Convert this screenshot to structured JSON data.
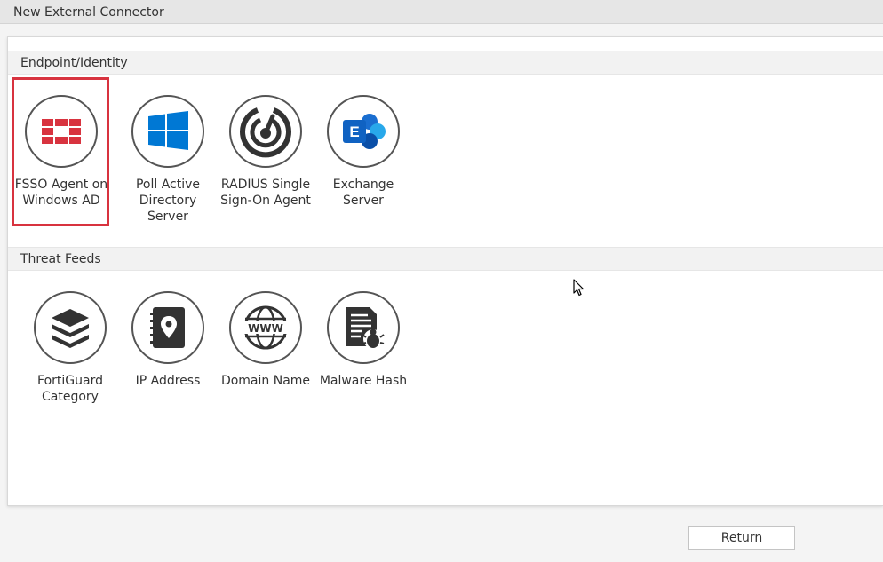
{
  "window": {
    "title": "New External Connector"
  },
  "sections": [
    {
      "title": "Endpoint/Identity",
      "items": [
        {
          "label": "FSSO Agent on\nWindows AD",
          "icon": "fortinet-logo-icon",
          "selected": true
        },
        {
          "label": "Poll Active\nDirectory\nServer",
          "icon": "windows-logo-icon",
          "selected": false
        },
        {
          "label": "RADIUS Single\nSign-On Agent",
          "icon": "radius-sso-icon",
          "selected": false
        },
        {
          "label": "Exchange\nServer",
          "icon": "exchange-logo-icon",
          "selected": false
        }
      ]
    },
    {
      "title": "Threat Feeds",
      "items": [
        {
          "label": "FortiGuard\nCategory",
          "icon": "stacked-layers-icon",
          "selected": false
        },
        {
          "label": "IP Address",
          "icon": "address-book-pin-icon",
          "selected": false
        },
        {
          "label": "Domain Name",
          "icon": "www-globe-icon",
          "selected": false
        },
        {
          "label": "Malware Hash",
          "icon": "malware-document-bug-icon",
          "selected": false
        }
      ]
    }
  ],
  "footer": {
    "return_label": "Return"
  },
  "colors": {
    "fortinet_red": "#d8333f",
    "microsoft_blue": "#0078d4",
    "exchange_blue": "#1a6ed0",
    "selection_border": "#d8333f",
    "icon_dark": "#333333"
  }
}
